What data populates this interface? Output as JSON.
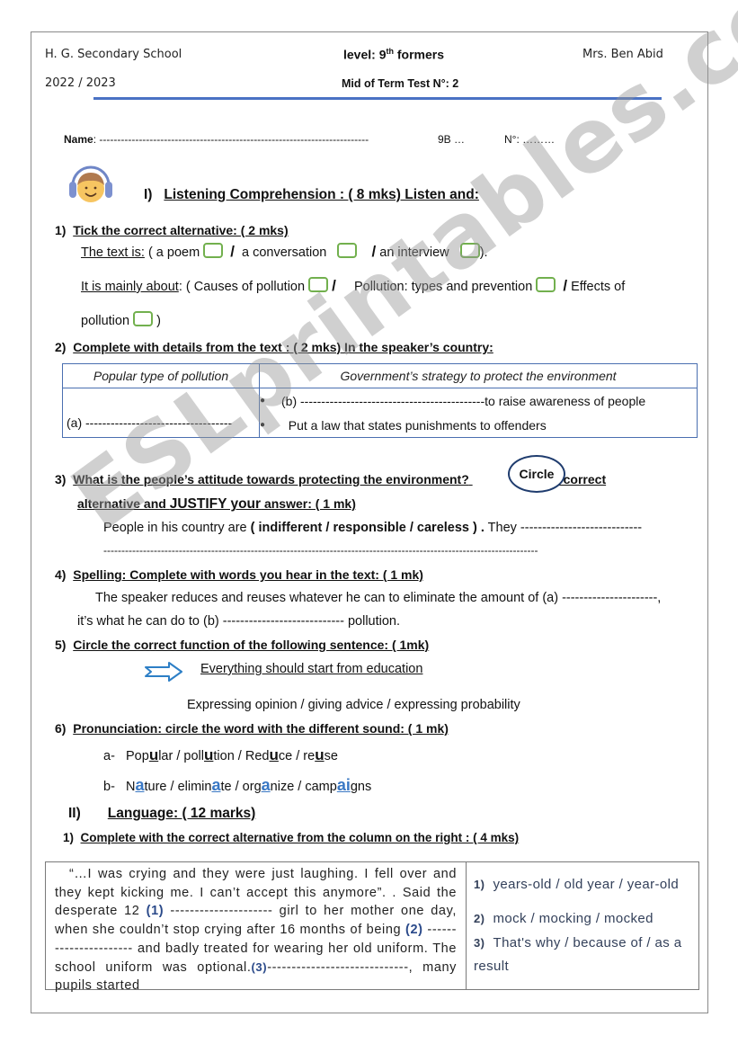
{
  "header": {
    "school": "H. G. Secondary School",
    "year": "2022 / 2023",
    "level_prefix": "level: 9",
    "level_sup": "th",
    "level_suffix": " formers",
    "test_title": "Mid of Term Test N°: 2",
    "teacher": "Mrs. Ben Abid"
  },
  "student": {
    "name_label": "Name",
    "name_blank": ": ---------------------------------------------------------------------------",
    "class": "9B …",
    "number": "N°: ………"
  },
  "section1": {
    "title_num": "I)",
    "title": "Listening Comprehension :   ( 8 mks)  Listen and:",
    "icon": "headphones-kid-icon"
  },
  "q1": {
    "num": "1)",
    "title": "Tick the correct alternative: ( 2 mks)",
    "line1_label": "The text is:",
    "line1_options": [
      "( a poem",
      "a conversation",
      "an interview"
    ],
    "line1_end": ").",
    "line2_label": "It is mainly about",
    "line2_colon": ":   ( Causes of pollution",
    "line2_opt2": "Pollution: types and prevention",
    "line2_opt3": "Effects of",
    "line3_text": "pollution",
    "line3_end": " )"
  },
  "q2": {
    "num": "2)",
    "title": "Complete with details from the text : ( 2 mks)  In the speaker’s country:",
    "table": {
      "headers": [
        "Popular type of pollution",
        "Government’s strategy to protect the environment"
      ],
      "cell_a": "(a) -----------------------------------",
      "bullets": [
        "(b) --------------------------------------------to raise awareness of people",
        "Put a law that states punishments to offenders"
      ]
    }
  },
  "q3": {
    "num": "3)",
    "title_part1": "What is the people’s attitude towards protecting the environment?",
    "circle_label": "Circle",
    "title_part2": "the correct",
    "title_line2_a": "alternative and ",
    "title_line2_b": "JUSTIFY your",
    "title_line2_c": " answer: ( 1 mk)",
    "sentence_start": "People in his country are ",
    "options": "( indifferent  / responsible  / careless ) .",
    "sentence_end": " They ----------------------------",
    "blank_line": "-------------------------------------------------------------------------------------------------------------------------"
  },
  "q4": {
    "num": "4)",
    "title": "Spelling: Complete with words you hear in the text: ( 1 mk)",
    "line1": "The speaker reduces and reuses whatever he can to eliminate the amount of (a)  ----------------------,",
    "line2": "it’s what he can do to (b) ---------------------------- pollution."
  },
  "q5": {
    "num": "5)",
    "title": "Circle the correct function of the following sentence: ( 1mk)",
    "sentence": "Everything should start from education",
    "options": "Expressing opinion     /  giving advice   /  expressing probability"
  },
  "q6": {
    "num": "6)",
    "title": "Pronunciation: circle the word with the different sound: ( 1 mk)",
    "a_label": "a-",
    "a_words": [
      {
        "pre": "Pop",
        "hl": "u",
        "post": "lar"
      },
      {
        "pre": "poll",
        "hl": "u",
        "post": "tion"
      },
      {
        "pre": "Red",
        "hl": "u",
        "post": "ce"
      },
      {
        "pre": "re",
        "hl": "u",
        "post": "se"
      }
    ],
    "b_label": "b-",
    "b_words": [
      {
        "pre": "N",
        "hl": "a",
        "post": "ture"
      },
      {
        "pre": "elimin",
        "hl": "a",
        "post": "te"
      },
      {
        "pre": "org",
        "hl": "a",
        "post": "nize"
      },
      {
        "pre": "camp",
        "hl": "ai",
        "post": "gns"
      }
    ],
    "separator": " / "
  },
  "section2": {
    "num": "II)",
    "title": "Language: ( 12 marks)"
  },
  "lang_q1": {
    "num": "1)",
    "title": "Complete with the correct alternative from the column on the right : ( 4 mks)",
    "passage": {
      "p1": "“…I was crying and they were just laughing.  I fell over and they kept kicking me. I can’t accept this anymore”.   . Said the desperate 12 ",
      "b1": "(1)",
      "p2": " ---------------------  girl to her mother one day, when she couldn’t stop crying after 16 months of being ",
      "b2": "(2)",
      "p3": " ---------------------- and badly treated for wearing her old uniform.  The school uniform was optional.",
      "b3": "(3)",
      "p4": "-----------------------------,  many  pupils  started"
    },
    "options": [
      {
        "num": "1)",
        "text": "years-old / old year / year-old"
      },
      {
        "num": "2)",
        "text": "mock / mocking / mocked"
      },
      {
        "num": "3)",
        "text": "That's why / because of / as a result"
      }
    ]
  },
  "watermark": "ESLprintables.com",
  "colors": {
    "accent_rule": "#4a72c4",
    "tick_box": "#72b04e",
    "table_border": "#4a6fb0",
    "highlight": "#3a78c4"
  }
}
